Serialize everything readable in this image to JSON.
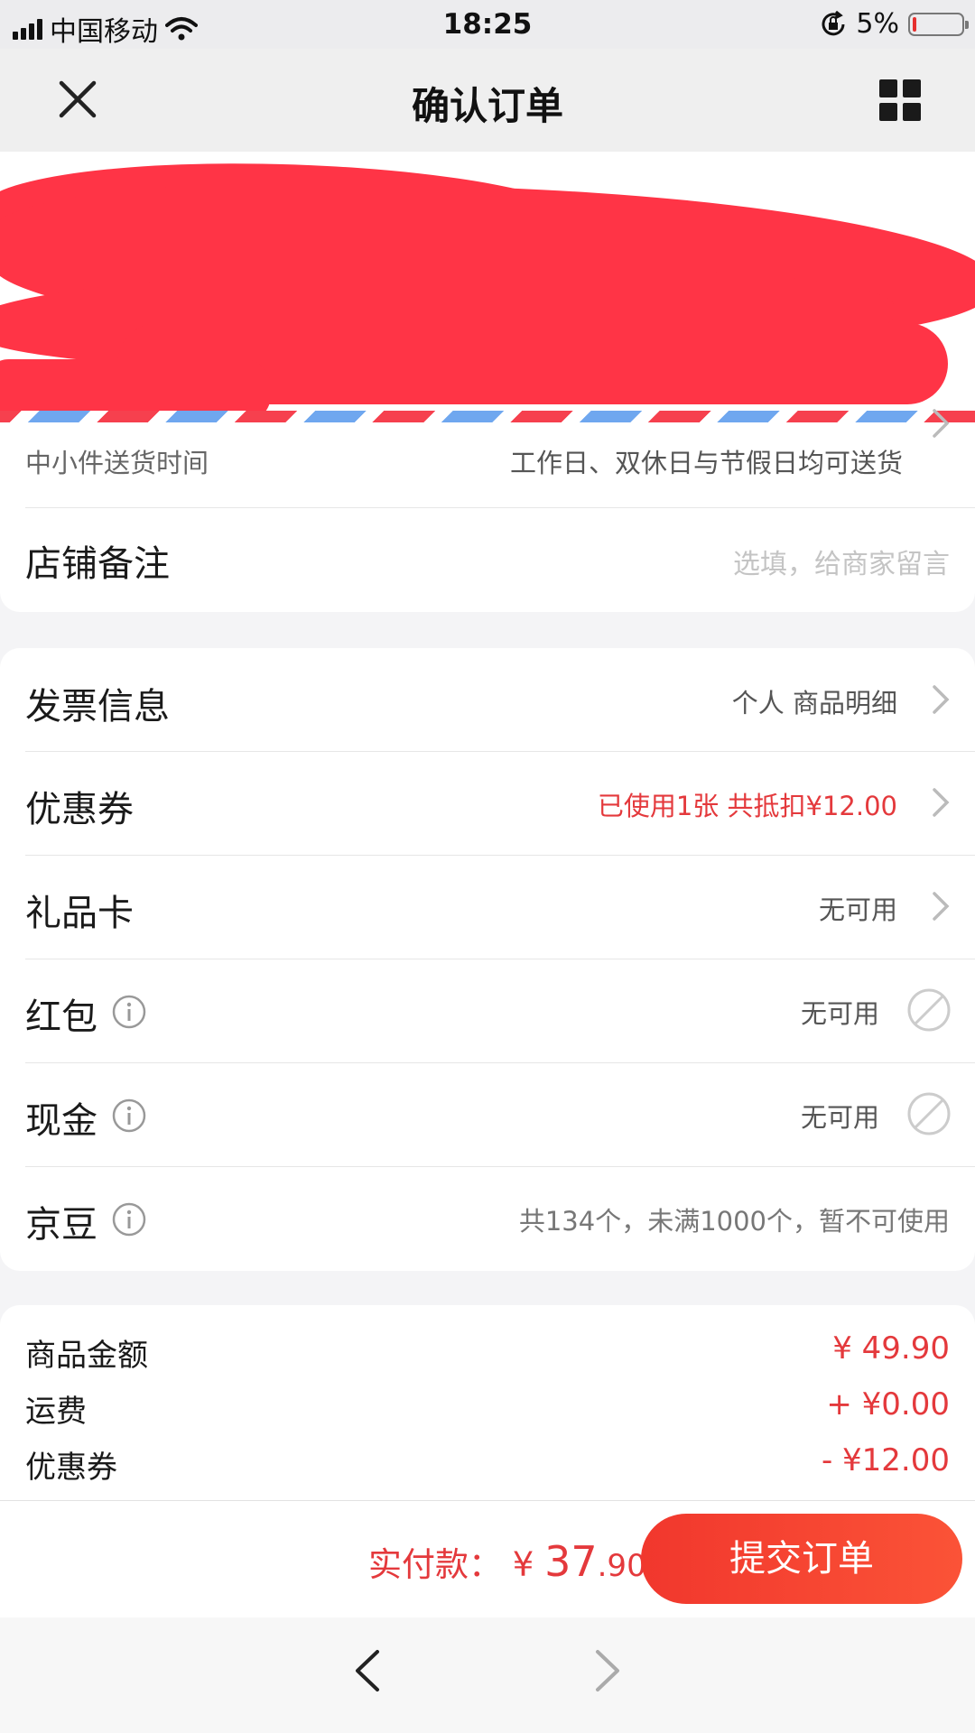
{
  "status_bar": {
    "carrier": "中国移动",
    "time": "18:25",
    "battery_percent": "5%",
    "battery_level": 0.05,
    "icons": [
      "signal-icon",
      "wifi-icon",
      "orientation-lock-icon",
      "battery-icon"
    ]
  },
  "header": {
    "title": "确认订单",
    "close_icon": "close-icon",
    "menu_icon": "grid-icon"
  },
  "delivery": {
    "label": "中小件送货时间",
    "value": "工作日、双休日与节假日均可送货"
  },
  "shop_note": {
    "label": "店铺备注",
    "placeholder": "选填，给商家留言"
  },
  "options": {
    "invoice": {
      "label": "发票信息",
      "value": "个人 商品明细"
    },
    "coupon": {
      "label": "优惠券",
      "value": "已使用1张 共抵扣¥12.00"
    },
    "gift_card": {
      "label": "礼品卡",
      "value": "无可用"
    },
    "red_packet": {
      "label": "红包",
      "value": "无可用"
    },
    "cash": {
      "label": "现金",
      "value": "无可用"
    },
    "jingdou": {
      "label": "京豆",
      "value": "共134个，未满1000个，暂不可使用"
    }
  },
  "summary": {
    "goods_label": "商品金额",
    "goods_amount": "¥ 49.90",
    "shipping_label": "运费",
    "shipping_amount": "+ ¥0.00",
    "coupon_label": "优惠券",
    "coupon_amount": "- ¥12.00"
  },
  "payment": {
    "label": "实付款：",
    "currency": "¥",
    "amount_int": "37",
    "amount_dec": ".90",
    "submit_label": "提交订单"
  },
  "colors": {
    "accent": "#e4393c",
    "submit": "#f5432f",
    "redaction": "#ff3446"
  }
}
